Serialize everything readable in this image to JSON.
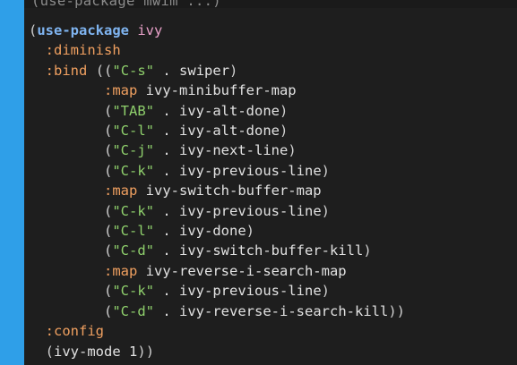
{
  "top_fragment": "(use-package mwim ...)",
  "code": {
    "l0": {
      "open": "(",
      "kw": "use-package",
      "sp": " ",
      "pkg": "ivy"
    },
    "l1": {
      "indent": "  ",
      "key": ":diminish"
    },
    "l2": {
      "indent": "  ",
      "key": ":bind",
      "sp": " ",
      "open": "((",
      "str": "\"C-s\"",
      "dot": " . ",
      "fn": "swiper",
      "close": ")"
    },
    "l3": {
      "indent": "         ",
      "key": ":map",
      "sp": " ",
      "fn": "ivy-minibuffer-map"
    },
    "l4": {
      "indent": "         ",
      "open": "(",
      "str": "\"TAB\"",
      "dot": " . ",
      "fn": "ivy-alt-done",
      "close": ")"
    },
    "l5": {
      "indent": "         ",
      "open": "(",
      "str": "\"C-l\"",
      "dot": " . ",
      "fn": "ivy-alt-done",
      "close": ")"
    },
    "l6": {
      "indent": "         ",
      "open": "(",
      "str": "\"C-j\"",
      "dot": " . ",
      "fn": "ivy-next-line",
      "close": ")"
    },
    "l7": {
      "indent": "         ",
      "open": "(",
      "str": "\"C-k\"",
      "dot": " . ",
      "fn": "ivy-previous-line",
      "close": ")"
    },
    "l8": {
      "indent": "         ",
      "key": ":map",
      "sp": " ",
      "fn": "ivy-switch-buffer-map"
    },
    "l9": {
      "indent": "         ",
      "open": "(",
      "str": "\"C-k\"",
      "dot": " . ",
      "fn": "ivy-previous-line",
      "close": ")"
    },
    "l10": {
      "indent": "         ",
      "open": "(",
      "str": "\"C-l\"",
      "dot": " . ",
      "fn": "ivy-done",
      "close": ")"
    },
    "l11": {
      "indent": "         ",
      "open": "(",
      "str": "\"C-d\"",
      "dot": " . ",
      "fn": "ivy-switch-buffer-kill",
      "close": ")"
    },
    "l12": {
      "indent": "         ",
      "key": ":map",
      "sp": " ",
      "fn": "ivy-reverse-i-search-map"
    },
    "l13": {
      "indent": "         ",
      "open": "(",
      "str": "\"C-k\"",
      "dot": " . ",
      "fn": "ivy-previous-line",
      "close": ")"
    },
    "l14": {
      "indent": "         ",
      "open": "(",
      "str": "\"C-d\"",
      "dot": " . ",
      "fn": "ivy-reverse-i-search-kill",
      "close": "))"
    },
    "l15": {
      "indent": "  ",
      "key": ":config"
    },
    "l16": {
      "indent": "  ",
      "open": "(",
      "fn": "ivy-mode",
      "sp": " ",
      "num": "1",
      "close": "))"
    }
  },
  "colors": {
    "accent_bar": "#2f9fe8",
    "background": "#1e1e1e",
    "keyword": "#7fb4f0",
    "package": "#e8a0c8",
    "keyword_arg": "#f0a060",
    "string": "#8fd06c"
  }
}
